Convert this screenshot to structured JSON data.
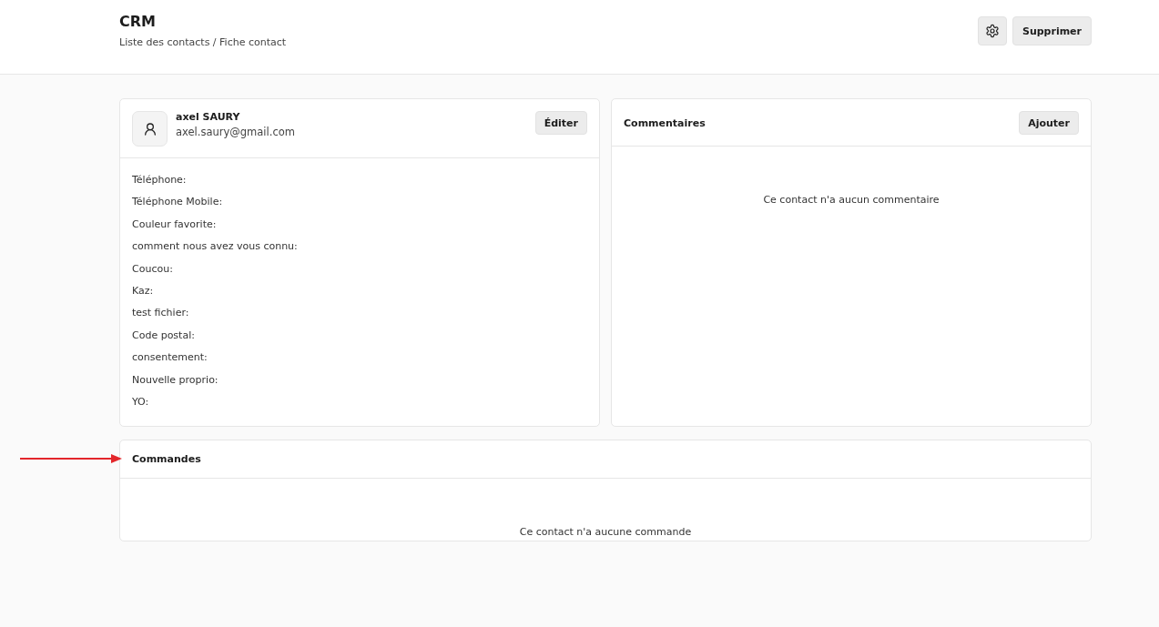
{
  "header": {
    "title": "CRM",
    "breadcrumb": "Liste des contacts / Fiche contact",
    "buttons": [
      "Supprimer"
    ]
  },
  "contact": {
    "name": "axel SAURY",
    "email": "axel.saury@gmail.com",
    "edit_button": "Éditer",
    "fields": [
      {
        "label": "Téléphone:"
      },
      {
        "label": "Téléphone Mobile:"
      },
      {
        "label": "Couleur favorite:"
      },
      {
        "label": "comment nous avez vous connu:"
      },
      {
        "label": "Coucou:"
      },
      {
        "label": "Kaz:"
      },
      {
        "label": "test fichier:"
      },
      {
        "label": "Code postal:"
      },
      {
        "label": "consentement:"
      },
      {
        "label": "Nouvelle proprio:"
      },
      {
        "label": "YO:"
      }
    ]
  },
  "comments": {
    "title": "Commentaires",
    "add_button": "Ajouter",
    "empty": "Ce contact n'a aucun commentaire"
  },
  "orders": {
    "title": "Commandes",
    "empty": "Ce contact n'a aucune commande"
  }
}
